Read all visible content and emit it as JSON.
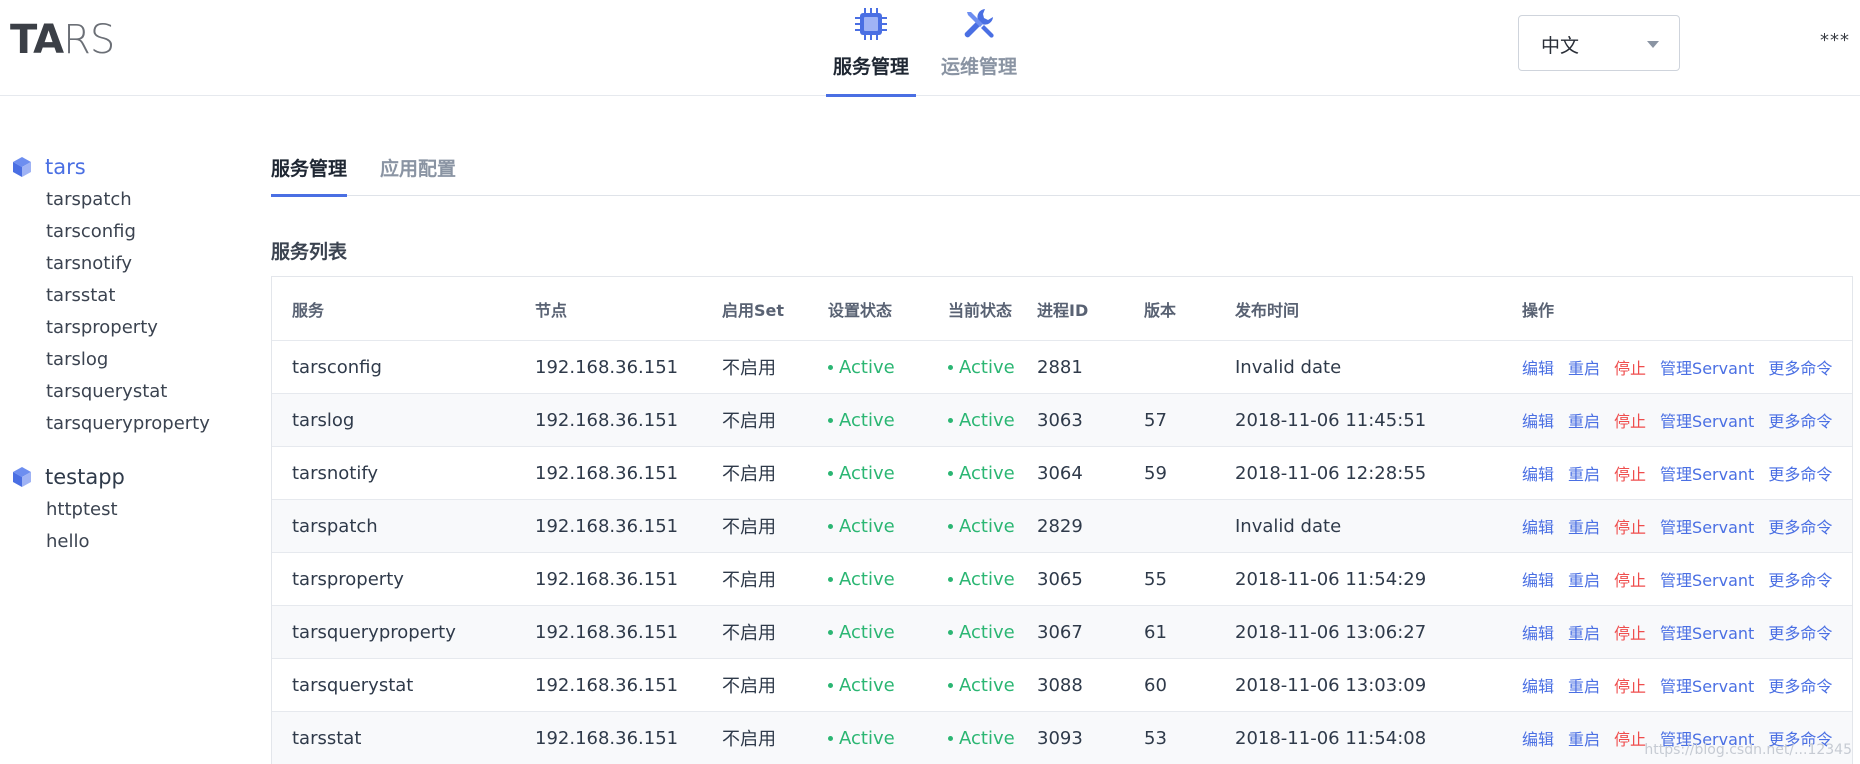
{
  "header": {
    "logo": {
      "part1": "TA",
      "part2": "RS"
    },
    "nav": [
      {
        "label": "服务管理",
        "icon": "chip-icon",
        "active": true
      },
      {
        "label": "运维管理",
        "icon": "wrench-icon",
        "active": false
      }
    ],
    "language": {
      "value": "中文"
    },
    "user_menu": "***"
  },
  "sidebar": {
    "apps": [
      {
        "name": "tars",
        "active": true,
        "servers": [
          "tarspatch",
          "tarsconfig",
          "tarsnotify",
          "tarsstat",
          "tarsproperty",
          "tarslog",
          "tarsquerystat",
          "tarsqueryproperty"
        ]
      },
      {
        "name": "testapp",
        "active": false,
        "servers": [
          "httptest",
          "hello"
        ]
      }
    ]
  },
  "main": {
    "tabs": [
      {
        "label": "服务管理",
        "active": true
      },
      {
        "label": "应用配置",
        "active": false
      }
    ],
    "section_title": "服务列表",
    "table": {
      "headers": [
        "服务",
        "节点",
        "启用Set",
        "设置状态",
        "当前状态",
        "进程ID",
        "版本",
        "发布时间",
        "操作"
      ],
      "ops": [
        "编辑",
        "重启",
        "停止",
        "管理Servant",
        "更多命令"
      ],
      "rows": [
        {
          "service": "tarsconfig",
          "node": "192.168.36.151",
          "set": "不启用",
          "setting": "Active",
          "current": "Active",
          "pid": "2881",
          "version": "",
          "time": "Invalid date"
        },
        {
          "service": "tarslog",
          "node": "192.168.36.151",
          "set": "不启用",
          "setting": "Active",
          "current": "Active",
          "pid": "3063",
          "version": "57",
          "time": "2018-11-06 11:45:51"
        },
        {
          "service": "tarsnotify",
          "node": "192.168.36.151",
          "set": "不启用",
          "setting": "Active",
          "current": "Active",
          "pid": "3064",
          "version": "59",
          "time": "2018-11-06 12:28:55"
        },
        {
          "service": "tarspatch",
          "node": "192.168.36.151",
          "set": "不启用",
          "setting": "Active",
          "current": "Active",
          "pid": "2829",
          "version": "",
          "time": "Invalid date"
        },
        {
          "service": "tarsproperty",
          "node": "192.168.36.151",
          "set": "不启用",
          "setting": "Active",
          "current": "Active",
          "pid": "3065",
          "version": "55",
          "time": "2018-11-06 11:54:29"
        },
        {
          "service": "tarsqueryproperty",
          "node": "192.168.36.151",
          "set": "不启用",
          "setting": "Active",
          "current": "Active",
          "pid": "3067",
          "version": "61",
          "time": "2018-11-06 13:06:27"
        },
        {
          "service": "tarsquerystat",
          "node": "192.168.36.151",
          "set": "不启用",
          "setting": "Active",
          "current": "Active",
          "pid": "3088",
          "version": "60",
          "time": "2018-11-06 13:03:09"
        },
        {
          "service": "tarsstat",
          "node": "192.168.36.151",
          "set": "不启用",
          "setting": "Active",
          "current": "Active",
          "pid": "3093",
          "version": "53",
          "time": "2018-11-06 11:54:08"
        }
      ]
    }
  },
  "watermark": "https://blog.csdn.net/...12345",
  "colors": {
    "accent": "#4a6fe3",
    "active_status": "#2bb673",
    "danger": "#ef4d4d"
  }
}
